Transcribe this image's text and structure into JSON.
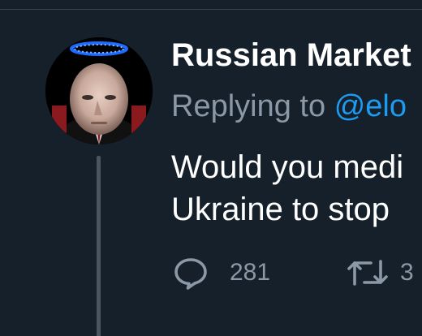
{
  "tweet": {
    "display_name": "Russian Market",
    "reply_prefix": "Replying to",
    "reply_handle": "@elo",
    "text_lines": [
      "Would you medi",
      "Ukraine to stop"
    ],
    "avatar_icon": "profile-avatar-with-halo"
  },
  "actions": {
    "reply": {
      "icon": "reply-bubble-icon",
      "count": "281"
    },
    "retweet": {
      "icon": "retweet-icon",
      "count": "3"
    }
  },
  "colors": {
    "background": "#15202b",
    "text_primary": "#ffffff",
    "text_secondary": "#8b98a5",
    "link": "#1d9bf0",
    "thread_line": "#4a5560"
  }
}
